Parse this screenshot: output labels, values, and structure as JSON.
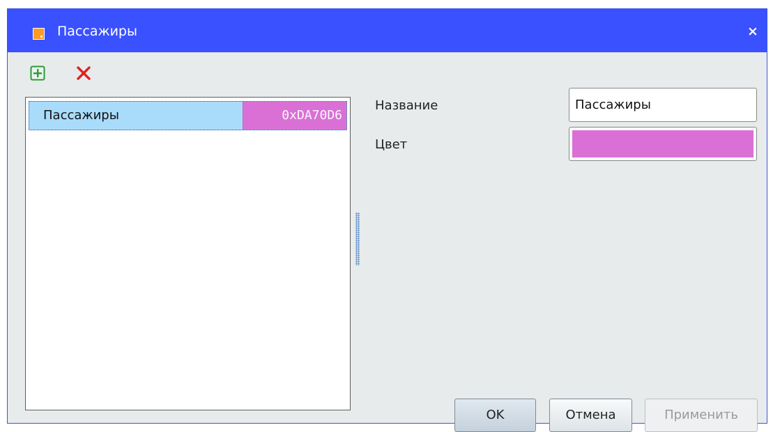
{
  "window": {
    "title": "Пассажиры",
    "icon": "app-window-icon",
    "close_label": "×"
  },
  "toolbar": {
    "add_icon": "add-plus-icon",
    "delete_icon": "delete-x-icon",
    "add_color": "#2e9a3a",
    "delete_color": "#e02020"
  },
  "list": {
    "items": [
      {
        "name": "Пассажиры",
        "color_hex": "0xDA70D6",
        "color": "#DA70D6",
        "selected": true
      }
    ]
  },
  "details": {
    "name_label": "Название",
    "name_value": "Пассажиры",
    "color_label": "Цвет",
    "color_value": "#DA70D6"
  },
  "buttons": {
    "ok": "OK",
    "cancel": "Отмена",
    "apply": "Применить"
  },
  "colors": {
    "titlebar": "#3A51FF",
    "selection": "#A9DCFB",
    "background": "#E7EBEB"
  }
}
